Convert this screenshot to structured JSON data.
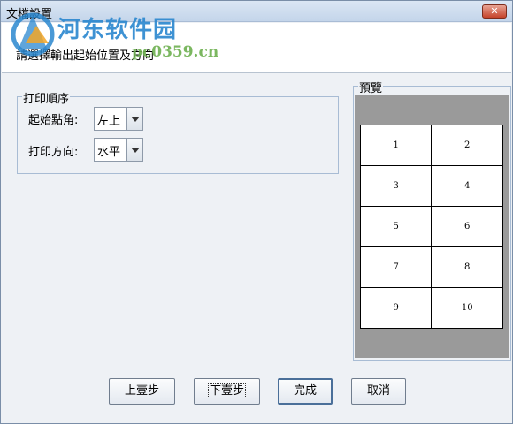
{
  "window": {
    "title": "文檔設置",
    "close_label": "✕"
  },
  "watermark": {
    "name": "河东软件园",
    "url": "pc0359.cn"
  },
  "instruction": "請選擇輸出起始位置及方向",
  "print_order": {
    "legend": "打印順序",
    "start_corner_label": "起始點角:",
    "start_corner_value": "左上",
    "direction_label": "打印方向:",
    "direction_value": "水平"
  },
  "preview": {
    "legend": "預覽",
    "cells": [
      [
        "1",
        "2"
      ],
      [
        "3",
        "4"
      ],
      [
        "5",
        "6"
      ],
      [
        "7",
        "8"
      ],
      [
        "9",
        "10"
      ]
    ]
  },
  "buttons": {
    "prev": "上壹步",
    "next": "下壹步",
    "finish": "完成",
    "cancel": "取消"
  },
  "colors": {
    "watermark_blue": "#2a87cf",
    "watermark_green": "#6db04f",
    "preview_bg": "#9a9a9a"
  }
}
